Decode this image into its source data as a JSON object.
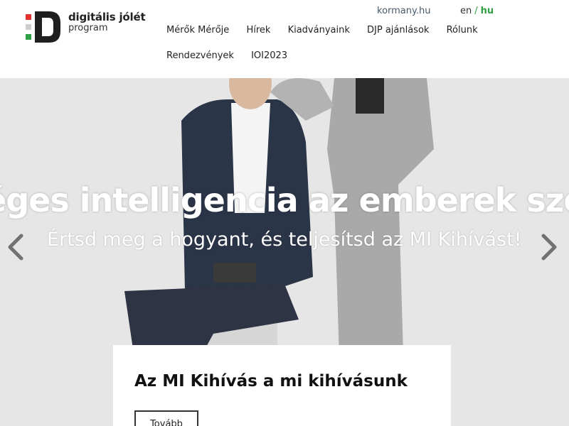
{
  "logo": {
    "line1": "digitális jólét",
    "line2": "program",
    "colors": {
      "red": "#e03131",
      "gray": "#cfcfcf",
      "green": "#2f9e44",
      "mark": "#1f1f1f"
    }
  },
  "utility": {
    "kormany_link": "kormany.hu",
    "lang_en": "en",
    "lang_separator": "/",
    "lang_hu": "hu",
    "active_lang_color": "#2f9e44"
  },
  "nav": {
    "row1": [
      "Mérők Mérője",
      "Hírek",
      "Kiadványaink",
      "DJP ajánlások",
      "Rólunk"
    ],
    "row2": [
      "Rendezvények",
      "IOI2023"
    ]
  },
  "hero": {
    "title": "éges intelligencia az emberek szolgá",
    "subtitle": "Értsd meg a hogyant, és teljesítsd az MI Kihívást!",
    "prev_icon": "chevron-left-icon",
    "next_icon": "chevron-right-icon"
  },
  "card": {
    "title": "Az MI Kihívás a mi kihívásunk",
    "button_label": "Tovább"
  }
}
